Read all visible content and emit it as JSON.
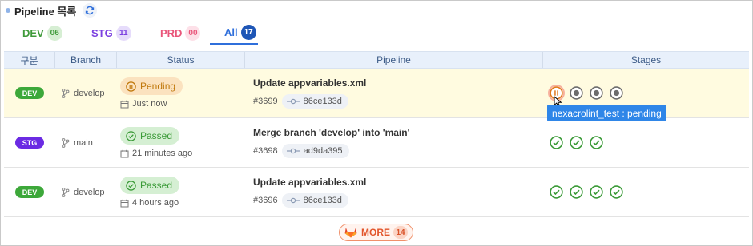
{
  "header": {
    "title": "Pipeline 목록",
    "refresh_icon": "refresh-icon"
  },
  "tabs": [
    {
      "label": "DEV",
      "count": "06"
    },
    {
      "label": "STG",
      "count": "11"
    },
    {
      "label": "PRD",
      "count": "00"
    },
    {
      "label": "All",
      "count": "17",
      "active": true
    }
  ],
  "table": {
    "columns": [
      "구분",
      "Branch",
      "Status",
      "Pipeline",
      "Stages"
    ],
    "rows": [
      {
        "env": "DEV",
        "branch": "develop",
        "status": "Pending",
        "time": "Just now",
        "title": "Update appvariables.xml",
        "id": "#3699",
        "commit": "86ce133d",
        "stages": [
          "pending",
          "created",
          "created",
          "created"
        ]
      },
      {
        "env": "STG",
        "branch": "main",
        "status": "Passed",
        "time": "21 minutes ago",
        "title": "Merge branch 'develop' into 'main'",
        "id": "#3698",
        "commit": "ad9da395",
        "stages": [
          "passed",
          "passed",
          "passed"
        ]
      },
      {
        "env": "DEV",
        "branch": "develop",
        "status": "Passed",
        "time": "4 hours ago",
        "title": "Update appvariables.xml",
        "id": "#3696",
        "commit": "86ce133d",
        "stages": [
          "passed",
          "passed",
          "passed",
          "passed"
        ]
      }
    ]
  },
  "tooltip": {
    "text": "nexacrolint_test : pending"
  },
  "more": {
    "label": "MORE",
    "count": "14"
  },
  "colors": {
    "dev": "#3da83a",
    "stg": "#6b2be3",
    "prd": "#e9557a",
    "all": "#2f6fdb",
    "pending": "#e0781c",
    "passed": "#3a9a37",
    "created": "#6d6d6d",
    "tooltip": "#2f86e8"
  }
}
